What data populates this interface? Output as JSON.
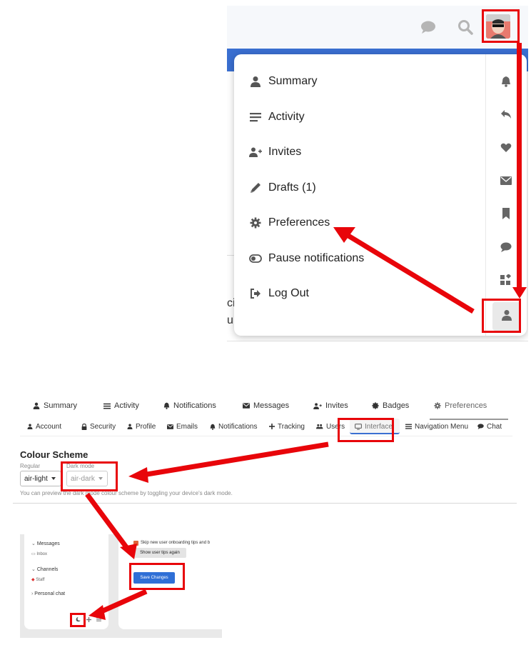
{
  "user_menu": {
    "items": [
      {
        "label": "Summary",
        "icon": "user-icon"
      },
      {
        "label": "Activity",
        "icon": "bars-icon"
      },
      {
        "label": "Invites",
        "icon": "user-plus-icon"
      },
      {
        "label": "Drafts (1)",
        "icon": "pencil-icon"
      },
      {
        "label": "Preferences",
        "icon": "gear-icon"
      },
      {
        "label": "Pause notifications",
        "icon": "toggle-icon"
      },
      {
        "label": "Log Out",
        "icon": "sign-out-icon"
      }
    ],
    "quick_icons": [
      "bell-icon",
      "reply-icon",
      "heart-icon",
      "envelope-icon",
      "bookmark-icon",
      "comment-icon",
      "widgets-icon",
      "user-icon"
    ]
  },
  "preferences": {
    "top_tabs": [
      {
        "label": "Summary"
      },
      {
        "label": "Activity"
      },
      {
        "label": "Notifications"
      },
      {
        "label": "Messages"
      },
      {
        "label": "Invites"
      },
      {
        "label": "Badges"
      },
      {
        "label": "Preferences"
      }
    ],
    "sub_tabs": [
      {
        "label": "Account"
      },
      {
        "label": "Security"
      },
      {
        "label": "Profile"
      },
      {
        "label": "Emails"
      },
      {
        "label": "Notifications"
      },
      {
        "label": "Tracking"
      },
      {
        "label": "Users"
      },
      {
        "label": "Interface"
      },
      {
        "label": "Navigation Menu"
      },
      {
        "label": "Chat"
      }
    ],
    "colour_scheme": {
      "title": "Colour Scheme",
      "regular_label": "Regular",
      "regular_value": "air-light",
      "dark_label": "Dark mode",
      "dark_value": "air-dark",
      "note": "You can preview the dark mode colour scheme by toggling your device's dark mode."
    }
  },
  "chat_panel": {
    "sidebar": {
      "messages_label": "Messages",
      "inbox_label": "Inbox",
      "channels_label": "Channels",
      "staff_label": "Staff",
      "personal_chat_label": "Personal chat"
    },
    "settings": {
      "skip_tips_label": "Skip new user onboarding tips and b",
      "show_tips_button": "Show user tips again",
      "save_button": "Save Changes"
    }
  },
  "colors": {
    "annotation_red": "#e8050a",
    "brand_blue": "#3a6fd1",
    "save_blue": "#2f6fd6"
  }
}
